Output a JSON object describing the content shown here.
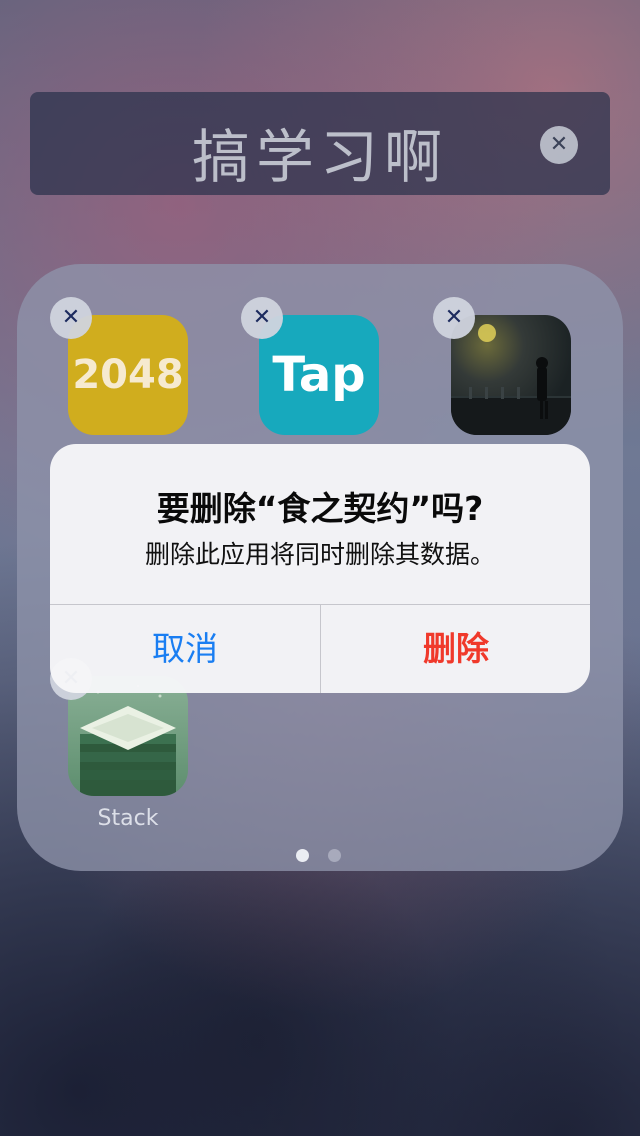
{
  "folder": {
    "name": "搞学习啊",
    "clear_icon": "close-icon"
  },
  "apps": [
    {
      "name": "2048",
      "label": "",
      "icon_text": "2048",
      "icon_color": "#d0ad1e"
    },
    {
      "name": "TapTap",
      "label": "",
      "icon_text": "Tap",
      "icon_color": "#17a9bd"
    },
    {
      "name": "食之契约",
      "label": "",
      "icon_text": "",
      "icon_color": "#1b2224"
    },
    {
      "name": "Stack",
      "label": "Stack",
      "icon_text": "",
      "icon_color": "#5d8e6e"
    }
  ],
  "delete_badge_icon": "close-icon",
  "page_indicator": {
    "count": 2,
    "current": 1
  },
  "alert": {
    "title": "要删除“食之契约”吗?",
    "message": "删除此应用将同时删除其数据。",
    "cancel_label": "取消",
    "delete_label": "删除",
    "cancel_color": "#1a7ef2",
    "delete_color": "#f0392b"
  }
}
